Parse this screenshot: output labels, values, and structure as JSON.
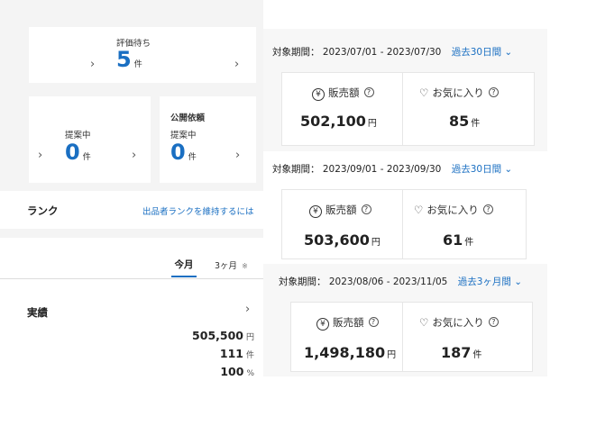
{
  "left": {
    "review_wait": {
      "label": "評価待ち",
      "count": "5",
      "unit": "件"
    },
    "proposal_a": {
      "label": "提案中",
      "count": "0",
      "unit": "件"
    },
    "public_request": {
      "title": "公開依頼",
      "label": "提案中",
      "count": "0",
      "unit": "件"
    },
    "rank": {
      "title": "ランク",
      "link": "出品者ランクを維持するには"
    },
    "tabs": {
      "current": "今月",
      "three_month": "3ヶ月",
      "three_month_note": "※"
    },
    "results": {
      "title": "実績",
      "rows": [
        {
          "value": "505,500",
          "unit": "円"
        },
        {
          "value": "111",
          "unit": "件"
        },
        {
          "value": "100",
          "unit": "%"
        }
      ]
    }
  },
  "panels": [
    {
      "period_label": "対象期間：",
      "period": "2023/07/01 - 2023/07/30",
      "range_link": "過去30日間",
      "sales_label": "販売額",
      "sales_value": "502,100",
      "sales_unit": "円",
      "fav_label": "お気に入り",
      "fav_value": "85",
      "fav_unit": "件"
    },
    {
      "period_label": "対象期間：",
      "period": "2023/09/01 - 2023/09/30",
      "range_link": "過去30日間",
      "sales_label": "販売額",
      "sales_value": "503,600",
      "sales_unit": "円",
      "fav_label": "お気に入り",
      "fav_value": "61",
      "fav_unit": "件"
    },
    {
      "period_label": "対象期間：",
      "period": "2023/08/06 - 2023/11/05",
      "range_link": "過去3ヶ月間",
      "sales_label": "販売額",
      "sales_value": "1,498,180",
      "sales_unit": "円",
      "fav_label": "お気に入り",
      "fav_value": "187",
      "fav_unit": "件"
    }
  ],
  "colors": {
    "accent": "#1a6fc2",
    "background": "#f4f4f4"
  },
  "icons": [
    "chevron-right-icon",
    "chevron-down-icon",
    "yen-icon",
    "heart-icon",
    "help-icon"
  ]
}
